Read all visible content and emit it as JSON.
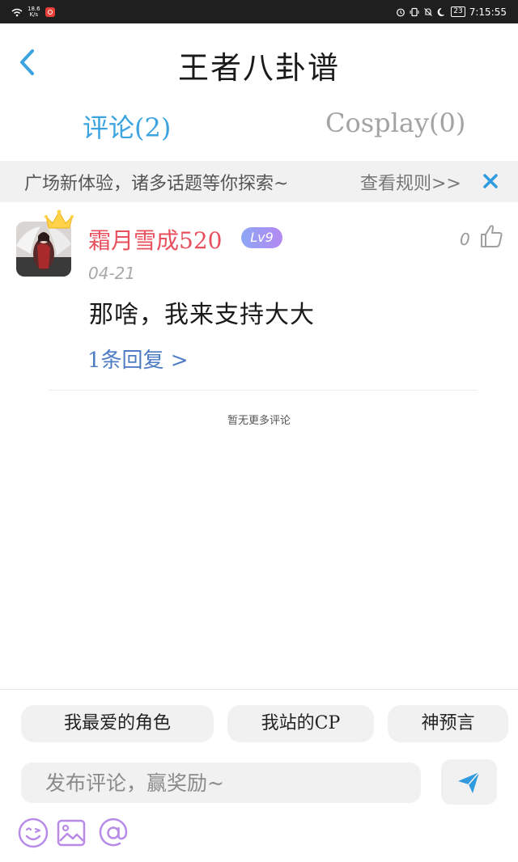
{
  "status_bar": {
    "net_speed_value": "18.6",
    "net_speed_unit": "K/s",
    "battery": "23",
    "time": "7:15:55"
  },
  "header": {
    "title": "王者八卦谱",
    "back_icon": "chevron-left-icon"
  },
  "tabs": [
    {
      "label": "评论(2)",
      "active": true
    },
    {
      "label": "Cosplay(0)",
      "active": false
    }
  ],
  "notice": {
    "text": "广场新体验，诸多话题等你探索~",
    "rules_link": "查看规则>>",
    "close_icon": "close-icon"
  },
  "comment": {
    "username": "霜月雪成520",
    "level": "Lv9",
    "likes": "0",
    "date": "04-21",
    "body": "那啥，我来支持大大",
    "reply_link": "1条回复 >"
  },
  "footer_note": "暂无更多评论",
  "composer": {
    "chips": [
      "我最爱的角色",
      "我站的CP",
      "神预言"
    ],
    "input_placeholder": "发布评论，赢奖励~",
    "send_icon": "send-icon",
    "tools": [
      "emoji-icon",
      "image-icon",
      "mention-icon"
    ]
  },
  "colors": {
    "accent_blue": "#3aa3e0",
    "username_red": "#e8505e",
    "reply_blue": "#4e7dc3",
    "level_badge_start": "#8da6f5",
    "level_badge_end": "#b489f2",
    "tool_icon_purple": "#b98be8"
  }
}
